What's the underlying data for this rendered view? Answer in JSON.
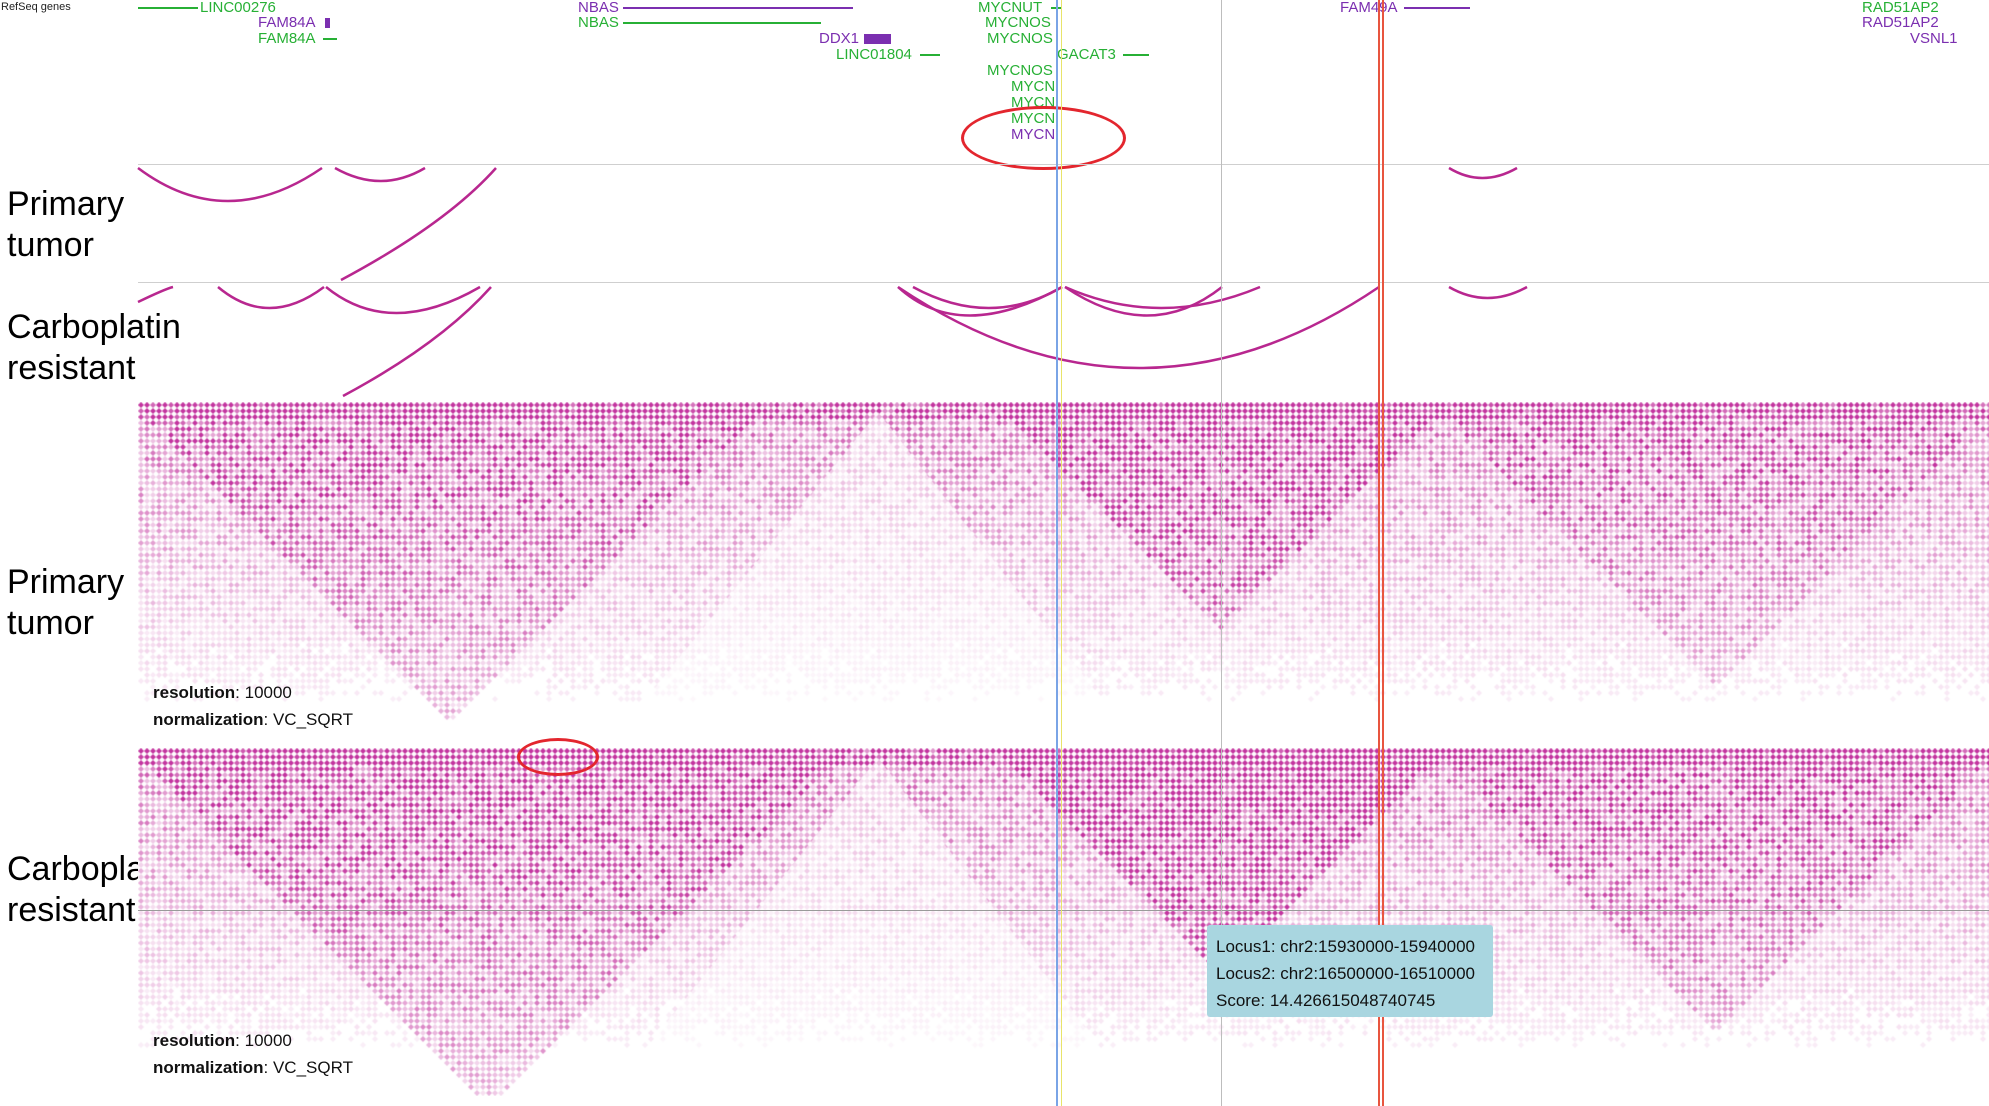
{
  "track": {
    "refseq_title": "RefSeq genes"
  },
  "labels": {
    "arc_primary": [
      "Primary",
      "tumor"
    ],
    "arc_carbo": [
      "Carboplatin",
      "resistant"
    ],
    "hic_primary": [
      "Primary",
      "tumor"
    ],
    "hic_carbo": [
      "Carboplatin",
      "resistant"
    ]
  },
  "genes": [
    {
      "name": "LINC00276",
      "color": "#27b035"
    },
    {
      "name": "FAM84A",
      "color": "#7b2fb0"
    },
    {
      "name": "FAM84A",
      "color": "#27b035"
    },
    {
      "name": "NBAS",
      "color": "#7b2fb0"
    },
    {
      "name": "NBAS",
      "color": "#27b035"
    },
    {
      "name": "DDX1",
      "color": "#7b2fb0"
    },
    {
      "name": "LINC01804",
      "color": "#27b035"
    },
    {
      "name": "MYCNUT",
      "color": "#27b035"
    },
    {
      "name": "MYCNOS",
      "color": "#27b035"
    },
    {
      "name": "MYCNOS",
      "color": "#27b035"
    },
    {
      "name": "GACAT3",
      "color": "#27b035"
    },
    {
      "name": "MYCNOS",
      "color": "#27b035"
    },
    {
      "name": "MYCN",
      "color": "#27b035"
    },
    {
      "name": "MYCN",
      "color": "#27b035"
    },
    {
      "name": "MYCN",
      "color": "#27b035"
    },
    {
      "name": "MYCN",
      "color": "#7b2fb0"
    },
    {
      "name": "FAM49A",
      "color": "#7b2fb0"
    },
    {
      "name": "RAD51AP2",
      "color": "#27b035"
    },
    {
      "name": "RAD51AP2",
      "color": "#7b2fb0"
    },
    {
      "name": "VSNL1",
      "color": "#7b2fb0"
    }
  ],
  "hic": {
    "primary": {
      "resolution_label": "resolution",
      "resolution_value": ": 10000",
      "normalization_label": "normalization",
      "normalization_value": ": VC_SQRT"
    },
    "carbo": {
      "resolution_label": "resolution",
      "resolution_value": ": 10000",
      "normalization_label": "normalization",
      "normalization_value": ": VC_SQRT"
    }
  },
  "tooltip": {
    "locus1": "Locus1: chr2:15930000-15940000",
    "locus2": "Locus2: chr2:16500000-16510000",
    "score": "Score: 14.426615048740745"
  },
  "colors": {
    "arc": "#b8278f",
    "heat": "#c02a9a",
    "guide_blue": "#7aa4e6",
    "guide_yellow": "#e8e46a",
    "guide_red": "#e8553f",
    "annotation": "#e3262e",
    "tooltip_bg": "#a9d6e0"
  }
}
